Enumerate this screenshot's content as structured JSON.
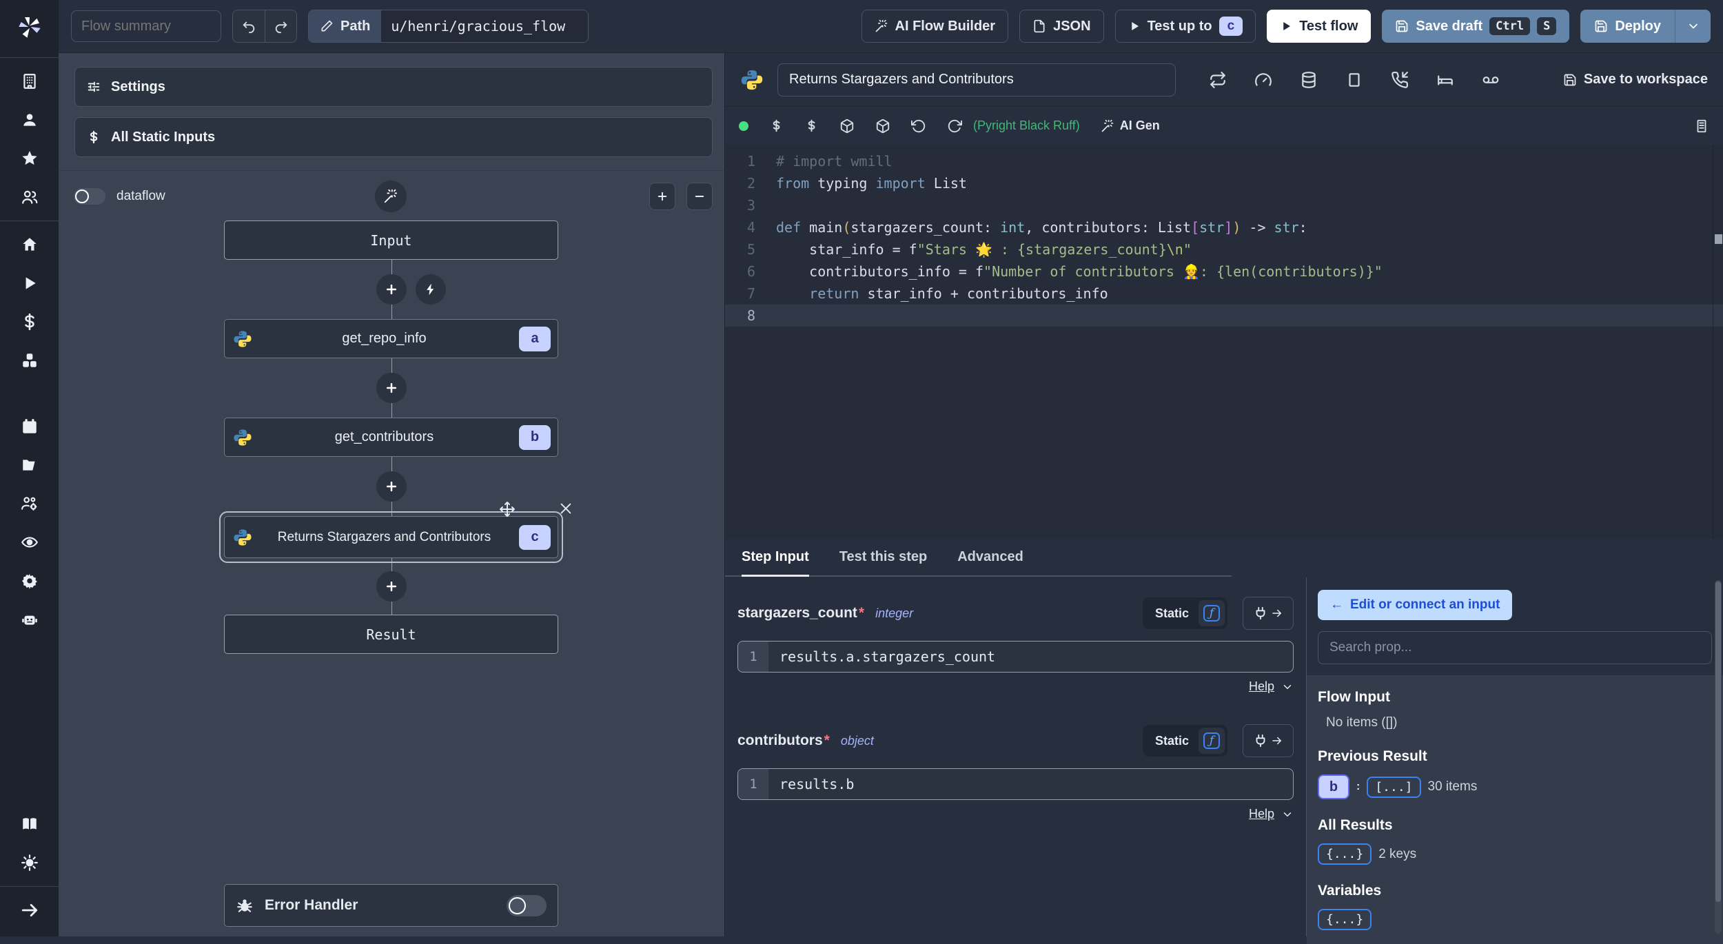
{
  "colors": {
    "accent_blue": "#3b82f6",
    "badge_bg": "#c7d2fe",
    "badge_text": "#312e81",
    "steel_button": "#6485aa",
    "success_green": "#4ade80",
    "connect_btn_bg": "#bfdbfe",
    "connect_btn_text": "#1d4ed8",
    "string_green": "#a3be8c",
    "graph_bg": "#3b4252",
    "panel_bg": "#272e3d"
  },
  "icons": {
    "dollar": "$",
    "function": "ƒ",
    "close": "×",
    "plus": "+",
    "minus": "−",
    "arrow_left": "←",
    "colon": ":",
    "chevron_down": "⌄"
  },
  "topbar": {
    "flow_summary_placeholder": "Flow summary",
    "path_label": "Path",
    "path_value": "u/henri/gracious_flow",
    "ai_flow_builder": "AI Flow Builder",
    "json_label": "JSON",
    "test_up_to": "Test up to",
    "test_up_to_step": "c",
    "test_flow": "Test flow",
    "save_draft": "Save draft",
    "save_draft_kbd": [
      "Ctrl",
      "S"
    ],
    "deploy": "Deploy"
  },
  "left_panel": {
    "settings_label": "Settings",
    "all_static_inputs_label": "All Static Inputs",
    "dataflow_label": "dataflow",
    "graph": {
      "input_label": "Input",
      "result_label": "Result",
      "steps": [
        {
          "name": "get_repo_info",
          "badge": "a"
        },
        {
          "name": "get_contributors",
          "badge": "b"
        },
        {
          "name": "Returns Stargazers and Contributors",
          "badge": "c"
        }
      ]
    },
    "error_handler_label": "Error Handler"
  },
  "step_editor": {
    "title_value": "Returns Stargazers and Contributors",
    "save_to_workspace": "Save to workspace",
    "assistants": "(Pyright Black Ruff)",
    "ai_gen": "AI Gen"
  },
  "editor": {
    "active_line": 8,
    "lines": [
      [
        {
          "t": "# import wmill",
          "c": "com"
        }
      ],
      [
        {
          "t": "from",
          "c": "kw"
        },
        {
          "t": " typing ",
          "c": "pl"
        },
        {
          "t": "import",
          "c": "kw"
        },
        {
          "t": " List",
          "c": "pl"
        }
      ],
      [],
      [
        {
          "t": "def",
          "c": "kw"
        },
        {
          "t": " main",
          "c": "pl"
        },
        {
          "t": "(",
          "c": "p1"
        },
        {
          "t": "stargazers_count",
          "c": "pl"
        },
        {
          "t": ": ",
          "c": "pl"
        },
        {
          "t": "int",
          "c": "ty"
        },
        {
          "t": ", contributors: List",
          "c": "pl"
        },
        {
          "t": "[",
          "c": "br"
        },
        {
          "t": "str",
          "c": "ty"
        },
        {
          "t": "]",
          "c": "br"
        },
        {
          "t": ")",
          "c": "p1"
        },
        {
          "t": " -> ",
          "c": "pl"
        },
        {
          "t": "str",
          "c": "ty"
        },
        {
          "t": ":",
          "c": "pl"
        }
      ],
      [
        {
          "t": "    star_info = f",
          "c": "pl"
        },
        {
          "t": "\"Stars 🌟 : {stargazers_count}",
          "c": "str"
        },
        {
          "t": "\\n",
          "c": "esc"
        },
        {
          "t": "\"",
          "c": "str"
        }
      ],
      [
        {
          "t": "    contributors_info = f",
          "c": "pl"
        },
        {
          "t": "\"Number of contributors 👷: {len(contributors)}\"",
          "c": "str"
        }
      ],
      [
        {
          "t": "    ",
          "c": "pl"
        },
        {
          "t": "return",
          "c": "kw"
        },
        {
          "t": " star_info + contributors_info",
          "c": "pl"
        }
      ],
      []
    ]
  },
  "tabs": [
    {
      "label": "Step Input"
    },
    {
      "label": "Test this step"
    },
    {
      "label": "Advanced"
    }
  ],
  "step_input": {
    "line_number": "1",
    "fields": [
      {
        "name": "stargazers_count",
        "required": "*",
        "type": "integer",
        "mode": "Static",
        "expr": "results.a.stargazers_count",
        "help_label": "Help"
      },
      {
        "name": "contributors",
        "required": "*",
        "type": "object",
        "mode": "Static",
        "expr": "results.b",
        "help_label": "Help"
      }
    ]
  },
  "prop_picker": {
    "edit_button": "Edit or connect an input",
    "search_placeholder": "Search prop...",
    "flow_input_title": "Flow Input",
    "flow_input_empty": "No items ([])",
    "previous_result_title": "Previous Result",
    "previous_result_key": "b",
    "previous_result_collapsed": "[...]",
    "previous_result_count": "30 items",
    "all_results_title": "All Results",
    "all_results_collapsed": "{...}",
    "all_results_count": "2 keys",
    "variables_title": "Variables",
    "variables_collapsed": "{...}"
  }
}
